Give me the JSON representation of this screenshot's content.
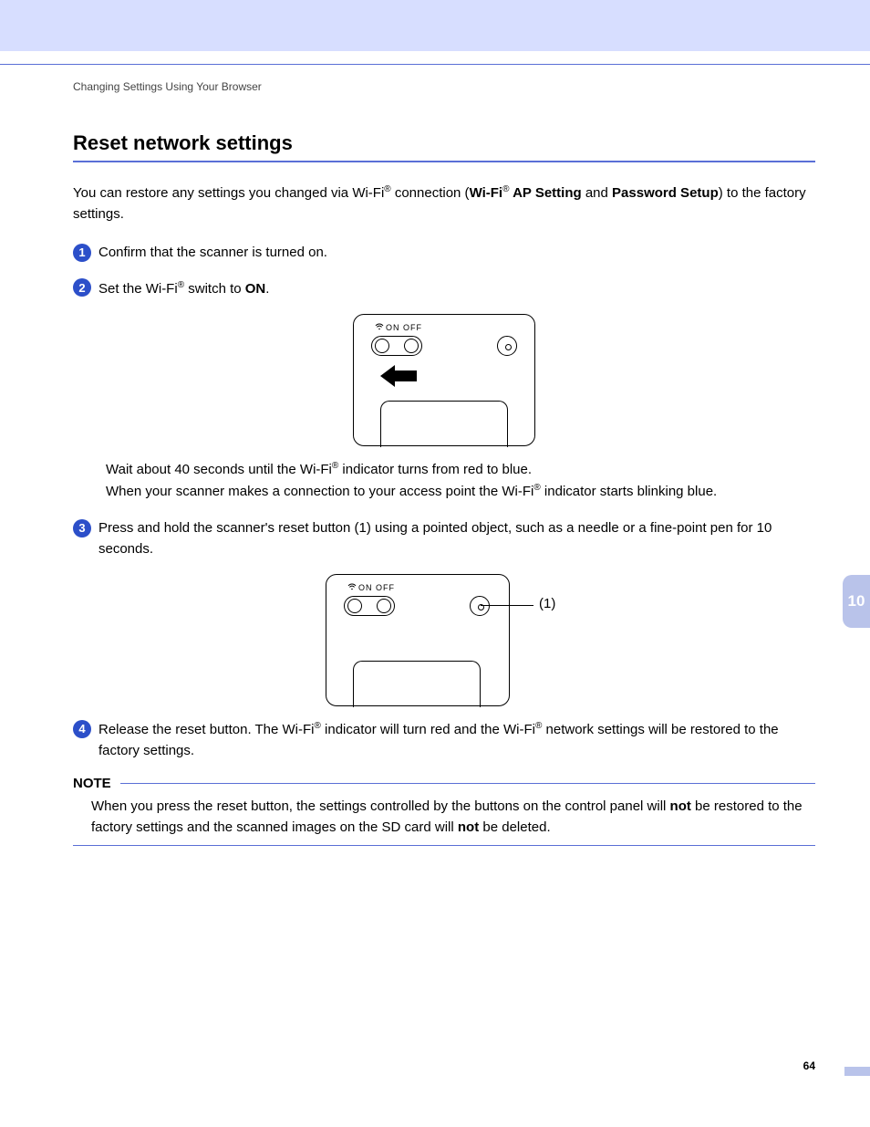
{
  "header": {
    "section": "Changing Settings Using Your Browser"
  },
  "title": "Reset network settings",
  "intro": {
    "t1": "You can restore any settings you changed via Wi-Fi",
    "t2": " connection (",
    "b1": "Wi-Fi",
    "b2": " AP Setting",
    "t3": " and ",
    "b3": "Password Setup",
    "t4": ") to the factory settings."
  },
  "steps": {
    "s1": {
      "num": "1",
      "text": "Confirm that the scanner is turned on."
    },
    "s2": {
      "num": "2",
      "t1": "Set the Wi-Fi",
      "t2": " switch to ",
      "b1": "ON",
      "t3": "."
    },
    "s2b": {
      "l1a": "Wait about 40 seconds until the Wi-Fi",
      "l1b": " indicator turns from red to blue.",
      "l2a": "When your scanner makes a connection to your access point the Wi-Fi",
      "l2b": " indicator starts blinking blue."
    },
    "s3": {
      "num": "3",
      "text": "Press and hold the scanner's reset button (1) using a pointed object, such as a needle or a fine-point pen for 10 seconds."
    },
    "s4": {
      "num": "4",
      "t1": "Release the reset button. The Wi-Fi",
      "t2": " indicator will turn red and the Wi-Fi",
      "t3": " network settings will be restored to the factory settings."
    }
  },
  "device": {
    "labels": "ON   OFF",
    "callout": "(1)"
  },
  "note": {
    "title": "NOTE",
    "t1": "When you press the reset button, the settings controlled by the buttons on the control panel will ",
    "b1": "not",
    "t2": " be restored to the factory settings and the scanned images on the SD card will ",
    "b2": "not",
    "t3": " be deleted."
  },
  "reg": "®",
  "tab": "10",
  "pageNumber": "64"
}
